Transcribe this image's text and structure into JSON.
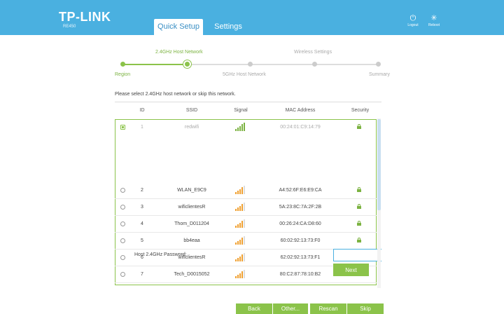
{
  "header": {
    "logo": "TP-LINK",
    "model": "RE450",
    "tabs": [
      "Quick Setup",
      "Settings"
    ],
    "logout_label": "Logout",
    "reboot_label": "Reboot"
  },
  "stepper": {
    "top_labels": [
      "2.4GHz Host Network",
      "Wireless Settings"
    ],
    "bottom_labels": [
      "Region",
      "5GHz Host Network",
      "Summary"
    ],
    "current_step": 2,
    "total_steps": 7
  },
  "instruction": "Please select 2.4GHz host network or skip this network.",
  "table": {
    "headers": [
      "ID",
      "SSID",
      "Signal",
      "MAC Address",
      "Security"
    ],
    "rows": [
      {
        "id": "1",
        "ssid": "redwifi",
        "signal": 5,
        "mac": "00:24:01:C9:14:79",
        "selected": true
      },
      {
        "id": "2",
        "ssid": "WLAN_E9C9",
        "signal": 4,
        "mac": "A4:52:6F:E6:E9:CA",
        "selected": false
      },
      {
        "id": "3",
        "ssid": "wificlientesR",
        "signal": 4,
        "mac": "5A:23:8C:7A:2F:2B",
        "selected": false
      },
      {
        "id": "4",
        "ssid": "Thom_D011204",
        "signal": 4,
        "mac": "00:26:24:CA:D8:60",
        "selected": false
      },
      {
        "id": "5",
        "ssid": "bb4eaa",
        "signal": 4,
        "mac": "60:02:92:13:73:F0",
        "selected": false
      },
      {
        "id": "6",
        "ssid": "wificlientesR",
        "signal": 4,
        "mac": "62:02:92:13:73:F1",
        "selected": false
      },
      {
        "id": "7",
        "ssid": "Tech_D0015052",
        "signal": 4,
        "mac": "80:C2:87:78:10:B2",
        "selected": false
      }
    ]
  },
  "password": {
    "label": "Host 2.4GHz Password:",
    "value": "",
    "next_label": "Next"
  },
  "footer": {
    "back": "Back",
    "other": "Other...",
    "rescan": "Rescan",
    "skip": "Skip"
  },
  "colors": {
    "header": "#4ab0e0",
    "accent": "#8bc34a",
    "signal_strong": "#7cb342",
    "signal_medium": "#f0a030"
  }
}
